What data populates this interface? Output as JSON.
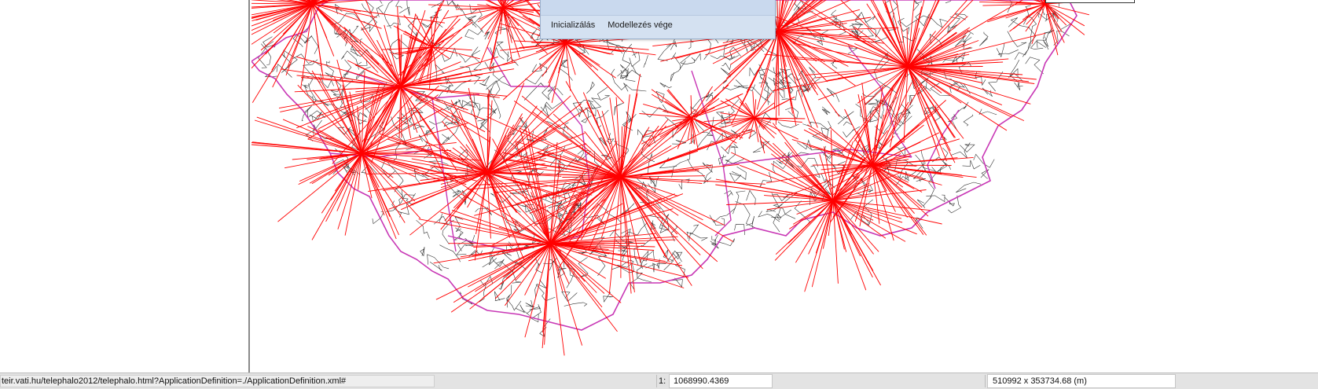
{
  "dialog": {
    "menu": [
      "Inicializálás",
      "Modellezés vége"
    ]
  },
  "map": {
    "district_border_color": "#333333",
    "county_border_color": "#c837b5",
    "flow_line_color": "#ff0000",
    "hubs_count": 16
  },
  "statusbar": {
    "url": "teir.vati.hu/telephalo2012/telephalo.html?ApplicationDefinition=./ApplicationDefinition.xml#",
    "scale_label": "1:",
    "scale_value": "1068990.4369",
    "extent": "510992 x 353734.68 (m)"
  }
}
